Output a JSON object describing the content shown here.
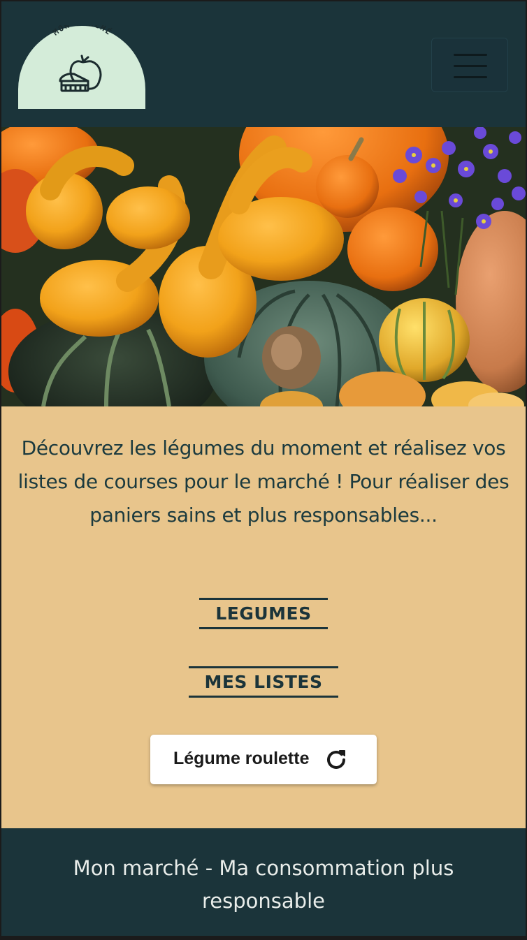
{
  "header": {
    "logo_text": "MON MARCHÉ",
    "logo_icon": "apple-basket-icon",
    "menu_icon": "hamburger-menu-icon"
  },
  "hero": {
    "image": "pumpkins-and-gourds-photo"
  },
  "main": {
    "intro": "Découvrez les légumes du moment et réalisez vos listes de courses pour le marché ! Pour réaliser des paniers sains et plus responsables...",
    "links": [
      {
        "label": "LEGUMES"
      },
      {
        "label": "MES LISTES"
      }
    ],
    "roulette_button": {
      "label": "Légume roulette",
      "icon": "refresh-icon"
    }
  },
  "footer": {
    "text": "Mon marché - Ma consommation plus responsable"
  },
  "colors": {
    "dark_teal": "#1b343a",
    "sand": "#e8c58c",
    "logo_bg": "#d4ecd9",
    "white": "#ffffff"
  }
}
